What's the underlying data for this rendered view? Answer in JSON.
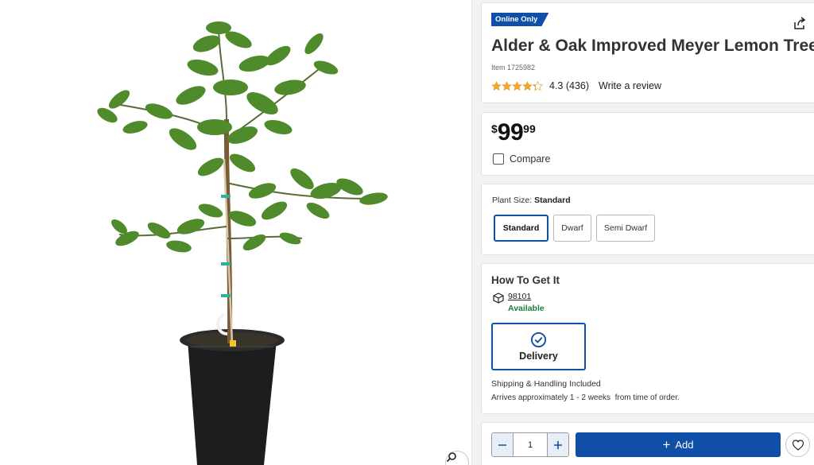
{
  "product": {
    "badge": "Online Only",
    "title": "Alder & Oak Improved Meyer Lemon Tree",
    "item_number": "Item 1725982",
    "rating": 4.3,
    "rating_text": "4.3 (436)",
    "write_review": "Write a review"
  },
  "price": {
    "currency": "$",
    "dollars": "99",
    "cents": "99",
    "compare_label": "Compare"
  },
  "plant_size": {
    "label": "Plant Size:",
    "selected": "Standard",
    "options": [
      "Standard",
      "Dwarf",
      "Semi Dwarf"
    ]
  },
  "fulfillment": {
    "title": "How To Get It",
    "zip": "98101",
    "availability": "Available",
    "delivery_label": "Delivery",
    "shipping_note": "Shipping & Handling Included",
    "arrival_note": "Arrives approximately 1 - 2 weeks  from time of order."
  },
  "purchase": {
    "quantity": "1",
    "add_label": "Add"
  },
  "colors": {
    "brand_blue": "#0f4fa8",
    "available_green": "#1a7f37",
    "star_gold": "#f5a623"
  },
  "icons": [
    "share-icon",
    "star-icon",
    "box-icon",
    "check-circle-icon",
    "minus-icon",
    "plus-icon",
    "heart-icon",
    "zoom-icon"
  ]
}
